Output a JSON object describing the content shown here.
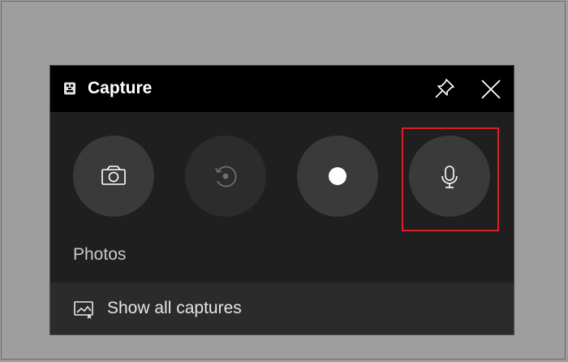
{
  "widget": {
    "title": "Capture",
    "title_icon": "capture-widget-icon",
    "pin_icon": "pin-icon",
    "close_icon": "close-icon"
  },
  "capture_buttons": [
    {
      "name": "screenshot",
      "icon": "camera-icon"
    },
    {
      "name": "record-last",
      "icon": "replay-icon",
      "disabled": true
    },
    {
      "name": "start-recording",
      "icon": "record-dot-icon"
    },
    {
      "name": "microphone",
      "icon": "microphone-icon",
      "highlighted": true
    }
  ],
  "section_label": "Photos",
  "show_all": {
    "label": "Show all captures",
    "icon": "gallery-icon"
  },
  "colors": {
    "titlebar": "#000000",
    "panel": "#1f1f1f",
    "button_bg": "#3a3a3a",
    "button_disabled_bg": "#2c2c2c",
    "highlight": "#d81f26",
    "desktop": "#9e9e9e"
  }
}
